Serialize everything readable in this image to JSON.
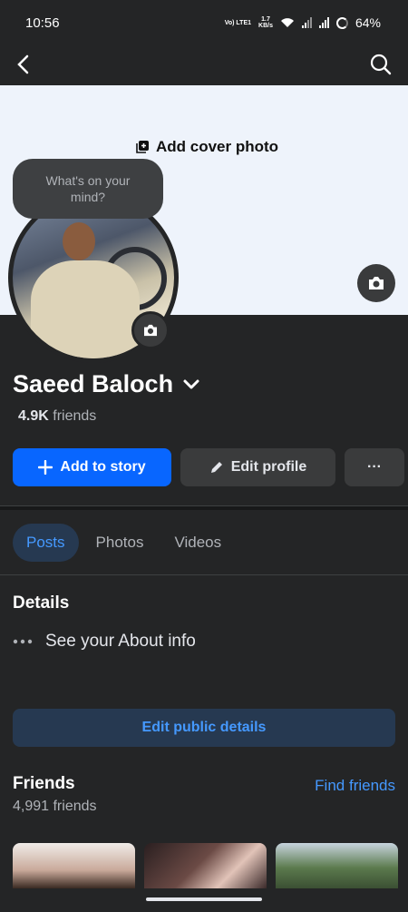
{
  "status": {
    "time": "10:56",
    "lte": "Vo) LTE1",
    "speed_top": "1.7",
    "speed_bottom": "KB/s",
    "battery": "64%"
  },
  "cover": {
    "add_label": "Add cover photo"
  },
  "mind": {
    "placeholder": "What's on your mind?"
  },
  "profile": {
    "name": "Saeed Baloch",
    "friends_count": "4.9K",
    "friends_word": "friends"
  },
  "actions": {
    "add_story": "Add to story",
    "edit_profile": "Edit profile",
    "more": "···"
  },
  "tabs": [
    {
      "label": "Posts"
    },
    {
      "label": "Photos"
    },
    {
      "label": "Videos"
    }
  ],
  "details": {
    "title": "Details",
    "about": "See your About info",
    "edit_public": "Edit public details"
  },
  "friends": {
    "title": "Friends",
    "find": "Find friends",
    "count": "4,991 friends"
  },
  "colors": {
    "accent": "#0866ff",
    "link": "#4599ff",
    "bg": "#242526"
  }
}
